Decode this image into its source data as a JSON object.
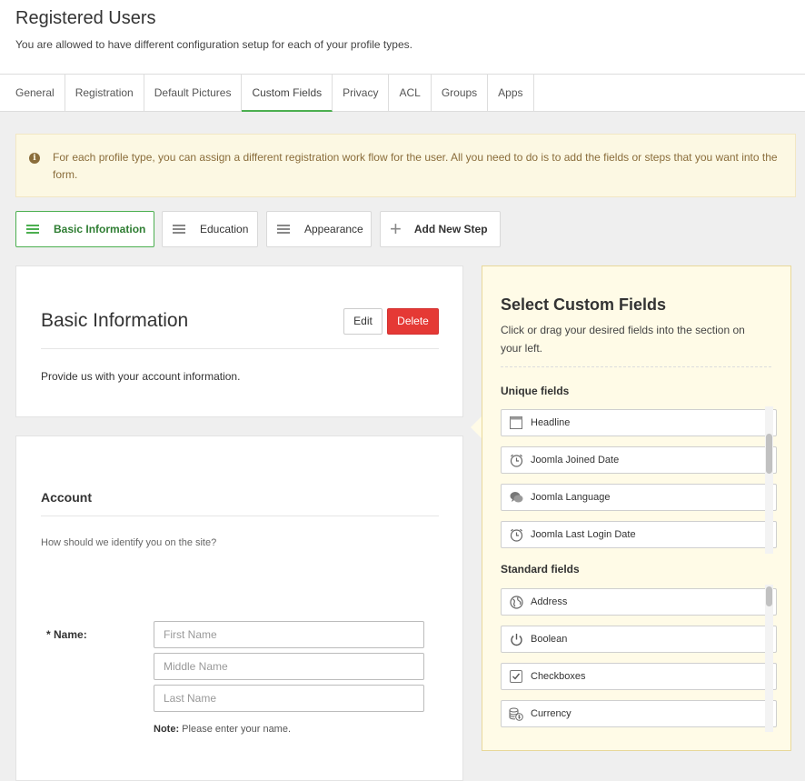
{
  "header": {
    "title": "Registered Users",
    "description": "You are allowed to have different configuration setup for each of your profile types."
  },
  "tabs": [
    {
      "label": "General",
      "active": false
    },
    {
      "label": "Registration",
      "active": false
    },
    {
      "label": "Default Pictures",
      "active": false
    },
    {
      "label": "Custom Fields",
      "active": true
    },
    {
      "label": "Privacy",
      "active": false
    },
    {
      "label": "ACL",
      "active": false
    },
    {
      "label": "Groups",
      "active": false
    },
    {
      "label": "Apps",
      "active": false
    }
  ],
  "alert": {
    "icon": "info-icon",
    "text": "For each profile type, you can assign a different registration work flow for the user. All you need to do is to add the fields or steps that you want into the form."
  },
  "steps": {
    "items": [
      {
        "label": "Basic Information",
        "active": true
      },
      {
        "label": "Education",
        "active": false
      },
      {
        "label": "Appearance",
        "active": false
      }
    ],
    "add_label": "Add New Step"
  },
  "basic_panel": {
    "title": "Basic Information",
    "edit_label": "Edit",
    "delete_label": "Delete",
    "description": "Provide us with your account information."
  },
  "account_panel": {
    "title": "Account",
    "description": "How should we identify you on the site?",
    "name_label": "* Name:",
    "first_placeholder": "First Name",
    "middle_placeholder": "Middle Name",
    "last_placeholder": "Last Name",
    "note_prefix": "Note:",
    "note_text": "Please enter your name."
  },
  "custom_fields": {
    "title": "Select Custom Fields",
    "description": "Click or drag your desired fields into the section on your left.",
    "unique_label": "Unique fields",
    "unique": [
      {
        "label": "Headline",
        "icon": "headline-icon"
      },
      {
        "label": "Joomla Joined Date",
        "icon": "clock-icon"
      },
      {
        "label": "Joomla Language",
        "icon": "chat-icon"
      },
      {
        "label": "Joomla Last Login Date",
        "icon": "clock-icon"
      }
    ],
    "standard_label": "Standard fields",
    "standard": [
      {
        "label": "Address",
        "icon": "globe-icon"
      },
      {
        "label": "Boolean",
        "icon": "power-icon"
      },
      {
        "label": "Checkboxes",
        "icon": "checkbox-icon"
      },
      {
        "label": "Currency",
        "icon": "currency-icon"
      }
    ]
  },
  "colors": {
    "accent": "#4caf50",
    "danger": "#e53935",
    "alert_bg": "#fcf8e3",
    "alert_text": "#8a6d3b",
    "custom_panel_bg": "#fffbe7"
  }
}
